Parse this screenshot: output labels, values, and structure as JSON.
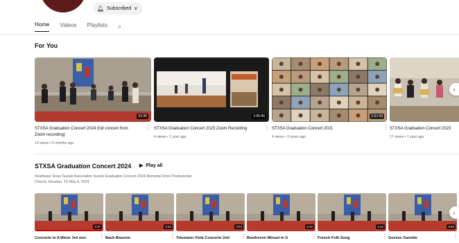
{
  "channel": {
    "subscribe_label": "Subscribed"
  },
  "tabs": [
    {
      "label": "Home",
      "active": true
    },
    {
      "label": "Videos",
      "active": false
    },
    {
      "label": "Playlists",
      "active": false
    }
  ],
  "for_you": {
    "title": "For You",
    "videos": [
      {
        "title": "STXSA Graduation Concert 2024 (full concert from",
        "title2": "Zoom recording)",
        "duration": "53:36",
        "meta": "13 views • 5 months ago"
      },
      {
        "title": "STXSA Graduation Concert 2023 Zoom Recording",
        "duration": "1:05:46",
        "meta": "4 views • 1 year ago"
      },
      {
        "title": "STXSA Graduation Concert 2021",
        "duration": "1:53:59",
        "meta": "4 views • 3 years ago"
      },
      {
        "title": "STXSA Graduation Concert 2023",
        "duration": "",
        "meta": "17 views • 1 year ago"
      }
    ]
  },
  "playlist": {
    "title": "STXSA Graduation Concert 2024",
    "play_all": "Play all",
    "desc1": "Southeast Texas Suzuki Association Suzuki Graduation Concert 2024 Memorial Drive Presbyterian",
    "desc2": "Church, Houston, TX May 4, 2024",
    "videos": [
      {
        "title": "Concerto in A Minor 3rd mvt.",
        "duration": "4:37"
      },
      {
        "title": "Bach Bourree",
        "duration": "4:34"
      },
      {
        "title": "Telemann Viola Concerto 2nd",
        "duration": "3:53"
      },
      {
        "title": "Beethoven Minuet in G",
        "duration": "2:42"
      },
      {
        "title": "French Folk Song",
        "duration": "1:12"
      },
      {
        "title": "Gossec Gavotte",
        "duration": "3:53"
      }
    ]
  },
  "colors": {
    "progress": "#cc0000",
    "stage_blue": "#3a5ea8",
    "stage_red": "#b83a2e"
  }
}
